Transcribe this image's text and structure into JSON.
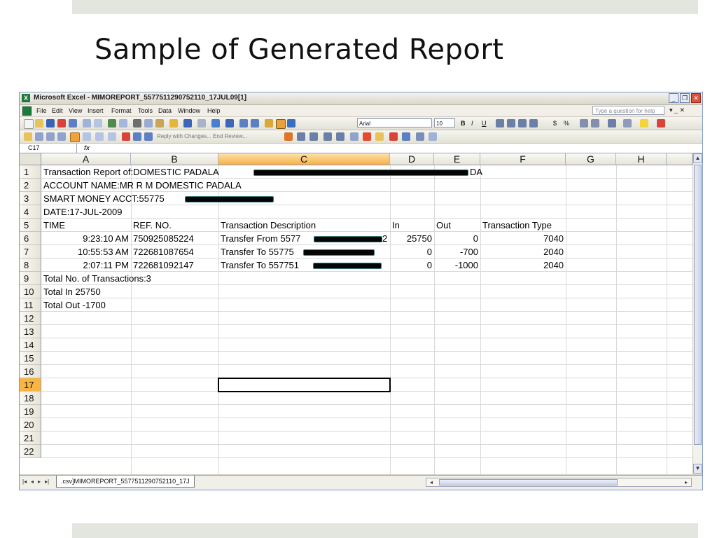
{
  "slide": {
    "title": "Sample of Generated Report"
  },
  "window": {
    "title": "Microsoft Excel - MIMOREPORT_5577511290752110_17JUL09[1]",
    "minimize": "_",
    "restore": "❐",
    "close": "✕"
  },
  "menu": {
    "items": [
      "File",
      "Edit",
      "View",
      "Insert",
      "Format",
      "Tools",
      "Data",
      "Window",
      "Help"
    ],
    "help_placeholder": "Type a question for help",
    "mdi_controls": "▾  _  ✕"
  },
  "toolbar": {
    "font_name": "Arial",
    "font_size": "10",
    "bold": "B",
    "italic": "I",
    "underline": "U",
    "currency": "$",
    "percent": "%",
    "reply_text": "Reply with Changes...  End Review..."
  },
  "formula_bar": {
    "name_box": "C17",
    "fx": "fx"
  },
  "columns": [
    "A",
    "B",
    "C",
    "D",
    "E",
    "F",
    "G",
    "H"
  ],
  "selected_column": "C",
  "rows": [
    "1",
    "2",
    "3",
    "4",
    "5",
    "6",
    "7",
    "8",
    "9",
    "10",
    "11",
    "12",
    "13",
    "14",
    "15",
    "16",
    "17",
    "18",
    "19",
    "20",
    "21",
    "22"
  ],
  "selected_row": "17",
  "cells": {
    "r1a": "Transaction Report of:DOMESTIC PADALA",
    "r1d": "DA",
    "r2a": "ACCOUNT NAME:MR R M DOMESTIC PADALA",
    "r3a": "SMART MONEY ACCT:55775",
    "r4a": "DATE:17-JUL-2009",
    "r5a": "TIME",
    "r5b": "REF. NO.",
    "r5c": "Transaction Description",
    "r5d": "In",
    "r5e": "Out",
    "r5f": "Transaction Type",
    "r6a": "9:23:10 AM",
    "r6b": "750925085224",
    "r6c": "Transfer From 5577",
    "r6c_tail": "2",
    "r6d": "25750",
    "r6e": "0",
    "r6f": "7040",
    "r7a": "10:55:53 AM",
    "r7b": "722681087654",
    "r7c": "Transfer To 55775",
    "r7d": "0",
    "r7e": "-700",
    "r7f": "2040",
    "r8a": "2:07:11 PM",
    "r8b": "722681092147",
    "r8c": "Transfer To 557751",
    "r8d": "0",
    "r8e": "-1000",
    "r8f": "2040",
    "r9a": "Total No. of Transactions:3",
    "r10a": "Total In 25750",
    "r11a": "Total Out -1700"
  },
  "sheet_tab": ".csv]MIMOREPORT_5577511290752110_17J",
  "colors": {
    "selected_header": "#f5b04a",
    "excel_green": "#1d7b3a",
    "band": "#e3e5df"
  }
}
